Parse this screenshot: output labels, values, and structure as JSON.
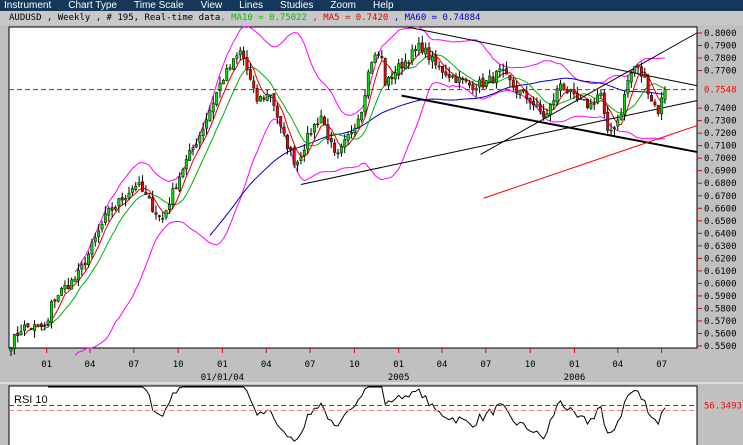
{
  "menu": [
    "Instrument",
    "Chart Type",
    "Time Scale",
    "View",
    "Lines",
    "Studies",
    "Zoom",
    "Help"
  ],
  "info": {
    "symbol_text": "AUDUSD , Weekly , # 195, Real-time data",
    "ma10": ", MA10 = 0.75022",
    "ma5": " , MA5 = 0.7420",
    "ma60": " , MA60 = 0.74884"
  },
  "colors": {
    "menu_bg": "#14375a",
    "up": "#00e000",
    "down": "#ee0000",
    "ma10": "#00b000",
    "ma5": "#e00000",
    "ma60": "#0000cc",
    "bollinger": "#ff00ff",
    "last_price": "#ff0000"
  },
  "chart_data": {
    "type": "candlestick",
    "instrument": "AUDUSD",
    "timeframe": "Weekly",
    "bars": 195,
    "ylim": [
      0.55,
      0.8
    ],
    "y_ticks": [
      "0.8000",
      "0.7900",
      "0.7800",
      "0.7700",
      "0.7400",
      "0.7300",
      "0.7200",
      "0.7100",
      "0.7000",
      "0.6900",
      "0.6800",
      "0.6700",
      "0.6600",
      "0.6500",
      "0.6400",
      "0.6300",
      "0.6200",
      "0.6100",
      "0.6000",
      "0.5900",
      "0.5800",
      "0.5700",
      "0.5600",
      "0.5500"
    ],
    "last_price": 0.7548,
    "last_price_label": "0.7548",
    "x_range": [
      "2002-10-19",
      "2006-07-08"
    ],
    "x_ticks": [
      {
        "date": "2003-01-01",
        "label": "01"
      },
      {
        "date": "2003-04-01",
        "label": "04"
      },
      {
        "date": "2003-07-01",
        "label": "07"
      },
      {
        "date": "2003-10-01",
        "label": "10"
      },
      {
        "date": "2004-01-01",
        "label": "01",
        "sub": "01/01/04"
      },
      {
        "date": "2004-04-01",
        "label": "04"
      },
      {
        "date": "2004-07-01",
        "label": "07"
      },
      {
        "date": "2004-10-01",
        "label": "10"
      },
      {
        "date": "2005-01-01",
        "label": "01",
        "sub": "2005"
      },
      {
        "date": "2005-04-01",
        "label": "04"
      },
      {
        "date": "2005-07-01",
        "label": "07"
      },
      {
        "date": "2005-10-01",
        "label": "10"
      },
      {
        "date": "2006-01-01",
        "label": "01",
        "sub": "2006"
      },
      {
        "date": "2006-04-01",
        "label": "04"
      },
      {
        "date": "2006-07-01",
        "label": "07"
      }
    ],
    "close_path": [
      [
        "2002-10-19",
        0.552
      ],
      [
        "2002-11-11",
        0.565
      ],
      [
        "2003-01-02",
        0.565
      ],
      [
        "2003-01-12",
        0.585
      ],
      [
        "2003-02-02",
        0.595
      ],
      [
        "2003-03-05",
        0.605
      ],
      [
        "2003-03-25",
        0.62
      ],
      [
        "2003-05-06",
        0.655
      ],
      [
        "2003-07-07",
        0.68
      ],
      [
        "2003-08-28",
        0.65
      ],
      [
        "2003-10-08",
        0.69
      ],
      [
        "2003-11-19",
        0.722
      ],
      [
        "2003-12-30",
        0.762
      ],
      [
        "2004-02-09",
        0.786
      ],
      [
        "2004-03-11",
        0.746
      ],
      [
        "2004-04-11",
        0.752
      ],
      [
        "2004-05-02",
        0.722
      ],
      [
        "2004-06-02",
        0.695
      ],
      [
        "2004-07-03",
        0.722
      ],
      [
        "2004-07-24",
        0.734
      ],
      [
        "2004-08-24",
        0.698
      ],
      [
        "2004-09-14",
        0.714
      ],
      [
        "2004-10-15",
        0.738
      ],
      [
        "2004-11-04",
        0.778
      ],
      [
        "2004-11-25",
        0.784
      ],
      [
        "2004-12-05",
        0.758
      ],
      [
        "2004-12-26",
        0.77
      ],
      [
        "2005-01-26",
        0.782
      ],
      [
        "2005-02-16",
        0.79
      ],
      [
        "2005-03-19",
        0.774
      ],
      [
        "2005-04-19",
        0.766
      ],
      [
        "2005-05-10",
        0.762
      ],
      [
        "2005-05-30",
        0.758
      ],
      [
        "2005-06-30",
        0.76
      ],
      [
        "2005-08-01",
        0.769
      ],
      [
        "2005-09-01",
        0.755
      ],
      [
        "2005-10-02",
        0.746
      ],
      [
        "2005-11-02",
        0.732
      ],
      [
        "2005-12-03",
        0.76
      ],
      [
        "2006-01-03",
        0.746
      ],
      [
        "2006-02-03",
        0.742
      ],
      [
        "2006-02-24",
        0.754
      ],
      [
        "2006-03-10",
        0.718
      ],
      [
        "2006-04-06",
        0.734
      ],
      [
        "2006-04-22",
        0.762
      ],
      [
        "2006-05-07",
        0.774
      ],
      [
        "2006-05-28",
        0.762
      ],
      [
        "2006-06-11",
        0.746
      ],
      [
        "2006-06-24",
        0.738
      ],
      [
        "2006-07-08",
        0.755
      ]
    ],
    "indicators": {
      "ma_periods": [
        5,
        10,
        60
      ],
      "bollinger": {
        "period": 20,
        "stddev": 2
      }
    },
    "trendlines": [
      {
        "from": [
          "2004-06-12",
          0.679
        ],
        "to": [
          "2006-09-12",
          0.746
        ],
        "color": "#000000",
        "width": 1
      },
      {
        "from": [
          "2005-06-20",
          0.703
        ],
        "to": [
          "2006-09-12",
          0.8
        ],
        "color": "#000000",
        "width": 1
      },
      {
        "from": [
          "2005-01-16",
          0.805
        ],
        "to": [
          "2006-09-12",
          0.758
        ],
        "color": "#000000",
        "width": 1
      },
      {
        "from": [
          "2005-01-07",
          0.75
        ],
        "to": [
          "2006-09-12",
          0.705
        ],
        "color": "#000000",
        "width": 2
      },
      {
        "from": [
          "2005-06-26",
          0.668
        ],
        "to": [
          "2006-09-12",
          0.726
        ],
        "color": "#ff0000",
        "width": 1
      }
    ],
    "rsi": {
      "label": "RSI 10",
      "period": 10,
      "level": 56.3493,
      "level_label": "56.3493"
    }
  }
}
